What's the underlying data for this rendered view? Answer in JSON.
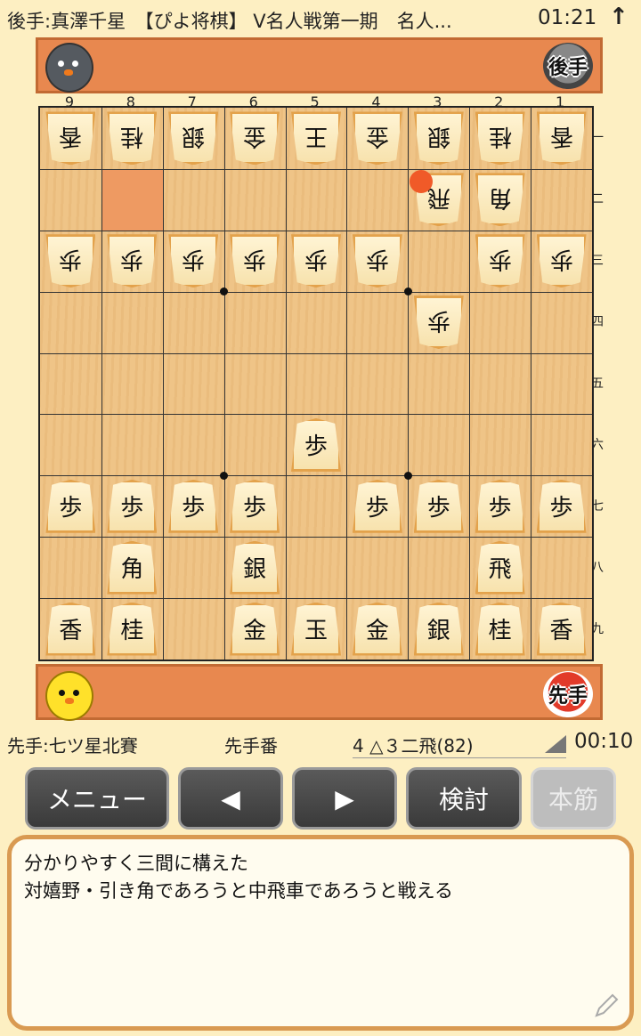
{
  "header": {
    "title": "後手:真澤千星　【ぴよ将棋】 V名人戦第一期　名人...",
    "clock": "01:21",
    "arrow": "↑"
  },
  "gote_stand": {
    "badge": "後手"
  },
  "sente_stand": {
    "badge": "先手"
  },
  "board": {
    "file_labels": [
      "9",
      "8",
      "7",
      "6",
      "5",
      "4",
      "3",
      "2",
      "1"
    ],
    "rank_labels": [
      "一",
      "二",
      "三",
      "四",
      "五",
      "六",
      "七",
      "八",
      "九"
    ],
    "pieces": [
      {
        "name": "gote-lance-9-1",
        "char": "香",
        "side": "gote",
        "file": 9,
        "rank": 1
      },
      {
        "name": "gote-knight-8-1",
        "char": "桂",
        "side": "gote",
        "file": 8,
        "rank": 1
      },
      {
        "name": "gote-silver-7-1",
        "char": "銀",
        "side": "gote",
        "file": 7,
        "rank": 1
      },
      {
        "name": "gote-gold-6-1",
        "char": "金",
        "side": "gote",
        "file": 6,
        "rank": 1
      },
      {
        "name": "gote-king-5-1",
        "char": "王",
        "side": "gote",
        "file": 5,
        "rank": 1
      },
      {
        "name": "gote-gold-4-1",
        "char": "金",
        "side": "gote",
        "file": 4,
        "rank": 1
      },
      {
        "name": "gote-silver-3-1",
        "char": "銀",
        "side": "gote",
        "file": 3,
        "rank": 1
      },
      {
        "name": "gote-knight-2-1",
        "char": "桂",
        "side": "gote",
        "file": 2,
        "rank": 1
      },
      {
        "name": "gote-lance-1-1",
        "char": "香",
        "side": "gote",
        "file": 1,
        "rank": 1
      },
      {
        "name": "gote-rook-3-2",
        "char": "飛",
        "side": "gote",
        "file": 3,
        "rank": 2
      },
      {
        "name": "gote-bishop-2-2",
        "char": "角",
        "side": "gote",
        "file": 2,
        "rank": 2
      },
      {
        "name": "gote-pawn-9-3",
        "char": "歩",
        "side": "gote",
        "file": 9,
        "rank": 3
      },
      {
        "name": "gote-pawn-8-3",
        "char": "歩",
        "side": "gote",
        "file": 8,
        "rank": 3
      },
      {
        "name": "gote-pawn-7-3",
        "char": "歩",
        "side": "gote",
        "file": 7,
        "rank": 3
      },
      {
        "name": "gote-pawn-6-3",
        "char": "歩",
        "side": "gote",
        "file": 6,
        "rank": 3
      },
      {
        "name": "gote-pawn-5-3",
        "char": "歩",
        "side": "gote",
        "file": 5,
        "rank": 3
      },
      {
        "name": "gote-pawn-4-3",
        "char": "歩",
        "side": "gote",
        "file": 4,
        "rank": 3
      },
      {
        "name": "gote-pawn-2-3",
        "char": "歩",
        "side": "gote",
        "file": 2,
        "rank": 3
      },
      {
        "name": "gote-pawn-1-3",
        "char": "歩",
        "side": "gote",
        "file": 1,
        "rank": 3
      },
      {
        "name": "gote-pawn-3-4",
        "char": "歩",
        "side": "gote",
        "file": 3,
        "rank": 4
      },
      {
        "name": "sente-pawn-5-6",
        "char": "歩",
        "side": "sente",
        "file": 5,
        "rank": 6
      },
      {
        "name": "sente-pawn-9-7",
        "char": "歩",
        "side": "sente",
        "file": 9,
        "rank": 7
      },
      {
        "name": "sente-pawn-8-7",
        "char": "歩",
        "side": "sente",
        "file": 8,
        "rank": 7
      },
      {
        "name": "sente-pawn-7-7",
        "char": "歩",
        "side": "sente",
        "file": 7,
        "rank": 7
      },
      {
        "name": "sente-pawn-6-7",
        "char": "歩",
        "side": "sente",
        "file": 6,
        "rank": 7
      },
      {
        "name": "sente-pawn-4-7",
        "char": "歩",
        "side": "sente",
        "file": 4,
        "rank": 7
      },
      {
        "name": "sente-pawn-3-7",
        "char": "歩",
        "side": "sente",
        "file": 3,
        "rank": 7
      },
      {
        "name": "sente-pawn-2-7",
        "char": "歩",
        "side": "sente",
        "file": 2,
        "rank": 7
      },
      {
        "name": "sente-pawn-1-7",
        "char": "歩",
        "side": "sente",
        "file": 1,
        "rank": 7
      },
      {
        "name": "sente-bishop-8-8",
        "char": "角",
        "side": "sente",
        "file": 8,
        "rank": 8
      },
      {
        "name": "sente-silver-6-8",
        "char": "銀",
        "side": "sente",
        "file": 6,
        "rank": 8
      },
      {
        "name": "sente-rook-2-8",
        "char": "飛",
        "side": "sente",
        "file": 2,
        "rank": 8
      },
      {
        "name": "sente-lance-9-9",
        "char": "香",
        "side": "sente",
        "file": 9,
        "rank": 9
      },
      {
        "name": "sente-knight-8-9",
        "char": "桂",
        "side": "sente",
        "file": 8,
        "rank": 9
      },
      {
        "name": "sente-gold-6-9",
        "char": "金",
        "side": "sente",
        "file": 6,
        "rank": 9
      },
      {
        "name": "sente-king-5-9",
        "char": "玉",
        "side": "sente",
        "file": 5,
        "rank": 9
      },
      {
        "name": "sente-gold-4-9",
        "char": "金",
        "side": "sente",
        "file": 4,
        "rank": 9
      },
      {
        "name": "sente-silver-3-9",
        "char": "銀",
        "side": "sente",
        "file": 3,
        "rank": 9
      },
      {
        "name": "sente-knight-2-9",
        "char": "桂",
        "side": "sente",
        "file": 2,
        "rank": 9
      },
      {
        "name": "sente-lance-1-9",
        "char": "香",
        "side": "sente",
        "file": 1,
        "rank": 9
      }
    ],
    "highlight_from": {
      "file": 8,
      "rank": 2
    },
    "last_move_marker": {
      "file": 3,
      "rank": 2
    },
    "colors": {
      "board": "#eec183",
      "highlight": "#ee9a62",
      "marker": "#f05a28",
      "stand": "#e8884f"
    }
  },
  "status": {
    "sente_player": "先手:七ツ星北賽",
    "turn": "先手番",
    "move": "4 △３二飛(82)",
    "timer": "00:10"
  },
  "buttons": {
    "menu": "メニュー",
    "prev": "◀",
    "next": "▶",
    "analyze": "検討",
    "mainline": "本筋"
  },
  "comment": {
    "line1": "分かりやすく三間に構えた",
    "line2": "対嬉野・引き角であろうと中飛車であろうと戦える"
  }
}
